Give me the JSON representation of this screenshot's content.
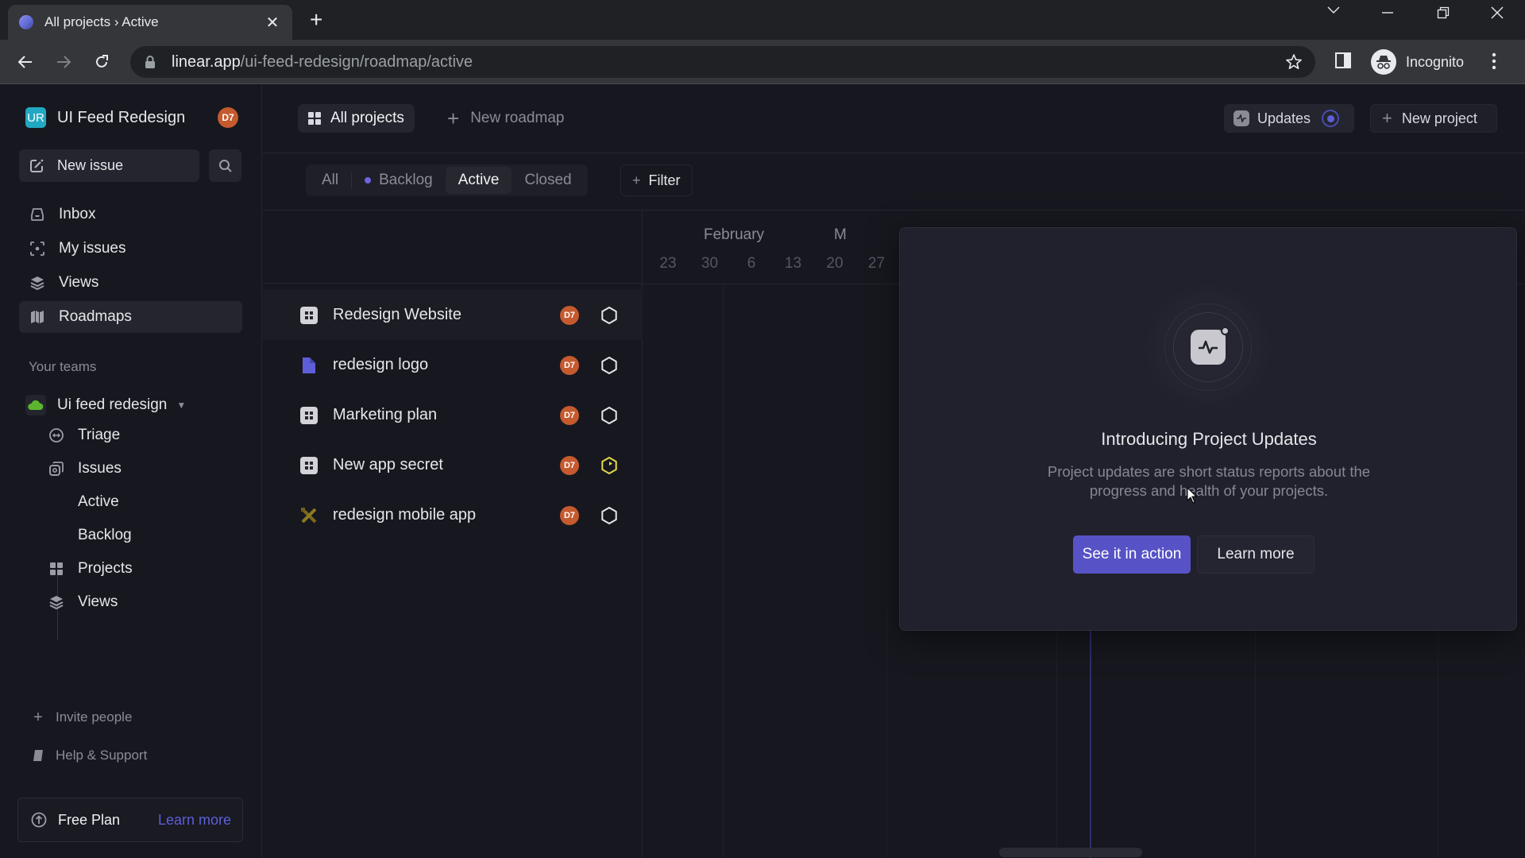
{
  "browser": {
    "tab_title": "All projects › Active",
    "url_host": "linear.app",
    "url_path": "/ui-feed-redesign/roadmap/active",
    "profile_label": "Incognito"
  },
  "workspace": {
    "logo_initials": "UR",
    "name": "UI Feed Redesign",
    "user_initials": "D7",
    "logo_color": "#21a8c2",
    "avatar_color": "#c55a2f"
  },
  "sidebar": {
    "new_issue_label": "New issue",
    "nav": [
      {
        "label": "Inbox",
        "icon": "inbox-icon"
      },
      {
        "label": "My issues",
        "icon": "my-issues-icon"
      },
      {
        "label": "Views",
        "icon": "layers-icon"
      },
      {
        "label": "Roadmaps",
        "icon": "map-icon",
        "selected": true
      }
    ],
    "teams_label": "Your teams",
    "team": {
      "name": "Ui feed redesign",
      "items": [
        {
          "label": "Triage",
          "icon": "triage-icon"
        },
        {
          "label": "Issues",
          "icon": "issues-icon"
        },
        {
          "label": "Active"
        },
        {
          "label": "Backlog"
        },
        {
          "label": "Projects",
          "icon": "projects-icon"
        },
        {
          "label": "Views",
          "icon": "layers-icon"
        }
      ]
    },
    "invite_label": "Invite people",
    "help_label": "Help & Support",
    "plan_label": "Free Plan",
    "plan_link": "Learn more"
  },
  "header": {
    "all_projects_label": "All projects",
    "new_roadmap_label": "New roadmap",
    "updates_label": "Updates",
    "new_project_label": "New project"
  },
  "filters": {
    "tabs": [
      {
        "label": "All"
      },
      {
        "label": "Backlog"
      },
      {
        "label": "Active",
        "active": true
      },
      {
        "label": "Closed"
      }
    ],
    "filter_label": "Filter"
  },
  "timeline": {
    "months": [
      "February",
      "M"
    ],
    "weeks": [
      "23",
      "30",
      "6",
      "13",
      "20",
      "27"
    ]
  },
  "projects": [
    {
      "name": "Redesign Website",
      "icon": "grid-project-icon",
      "lead": "D7",
      "status": "planned"
    },
    {
      "name": "redesign logo",
      "icon": "document-icon",
      "lead": "D7",
      "status": "planned"
    },
    {
      "name": "Marketing plan",
      "icon": "grid-project-icon",
      "lead": "D7",
      "status": "planned"
    },
    {
      "name": "New app secret",
      "icon": "grid-project-icon",
      "lead": "D7",
      "status": "in-progress"
    },
    {
      "name": "redesign mobile app",
      "icon": "tools-icon",
      "lead": "D7",
      "status": "planned"
    }
  ],
  "popover": {
    "title": "Introducing Project Updates",
    "description": "Project updates are short status reports about the progress and health of your projects.",
    "primary_button": "See it in action",
    "secondary_button": "Learn more"
  },
  "colors": {
    "accent": "#5753c6",
    "in_progress": "#e4d94a",
    "backlog_dot": "#6d64e0"
  }
}
